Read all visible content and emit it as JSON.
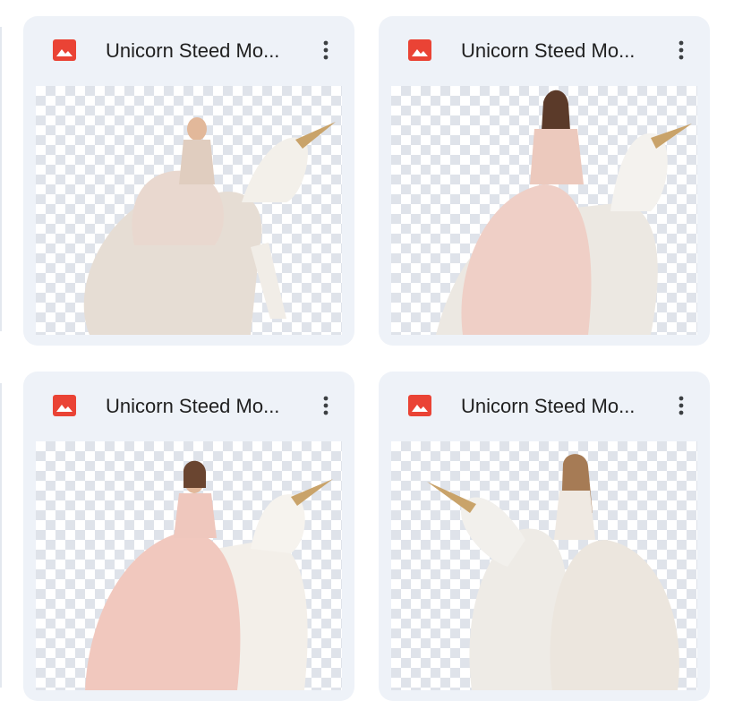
{
  "files": [
    {
      "title": "Unicorn Steed Mo...",
      "icon": "image-icon",
      "menu_icon": "more-vert-icon",
      "dress_color": "#e9d8cf"
    },
    {
      "title": "Unicorn Steed Mo...",
      "icon": "image-icon",
      "menu_icon": "more-vert-icon",
      "dress_color": "#efcfc6"
    },
    {
      "title": "Unicorn Steed Mo...",
      "icon": "image-icon",
      "menu_icon": "more-vert-icon",
      "dress_color": "#f1c8be"
    },
    {
      "title": "Unicorn Steed Mo...",
      "icon": "image-icon",
      "menu_icon": "more-vert-icon",
      "dress_color": "#ece6de"
    }
  ],
  "colors": {
    "card_bg": "#eef2f8",
    "icon_red": "#ea4335",
    "title_text": "#1f1f1f",
    "checker": "#dfe3ea"
  }
}
